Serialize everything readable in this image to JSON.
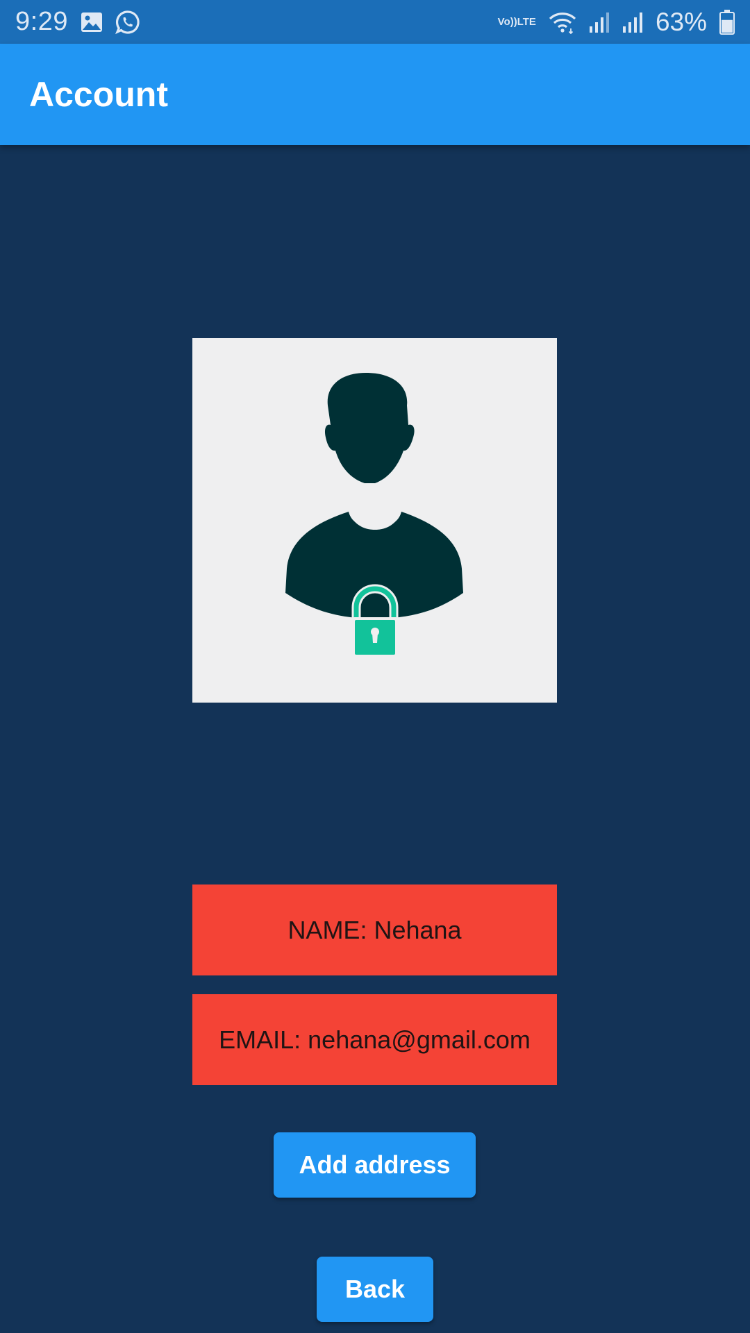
{
  "status_bar": {
    "time": "9:29",
    "left_icons": [
      "image-icon",
      "whatsapp-icon"
    ],
    "volte_top": "Vo))",
    "volte_bottom": "LTE",
    "right_icons": [
      "wifi-icon",
      "signal-icon",
      "signal-icon",
      "battery-icon"
    ],
    "battery_percent": "63%",
    "battery_level": 0.63
  },
  "app_bar": {
    "title": "Account",
    "color": "#2196f3"
  },
  "profile": {
    "avatar_icon": "user-lock-icon",
    "name_text": "NAME: Nehana",
    "email_text": "EMAIL: nehana@gmail.com",
    "box_color": "#f44336"
  },
  "actions": {
    "add_address_label": "Add address",
    "back_label": "Back",
    "button_color": "#2196f3"
  },
  "colors": {
    "background": "#133357",
    "status_bar": "#1b6eb8",
    "avatar_figure": "#003035",
    "lock": "#12c29a"
  }
}
